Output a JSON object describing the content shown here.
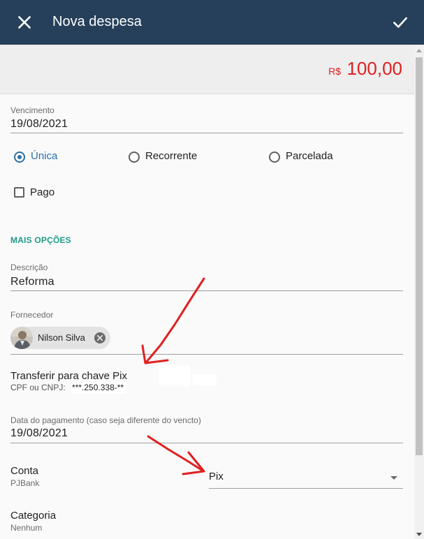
{
  "header": {
    "title": "Nova despesa",
    "close_icon": "close-icon",
    "confirm_icon": "check-icon",
    "background": "#263f5a"
  },
  "amount": {
    "currency": "R$",
    "value": "100,00",
    "color": "#e02020"
  },
  "form": {
    "due_date": {
      "label": "Vencimento",
      "value": "19/08/2021"
    },
    "recurrence": {
      "options": [
        "Única",
        "Recorrente",
        "Parcelada"
      ],
      "selected": "Única"
    },
    "paid": {
      "label": "Pago",
      "checked": false
    },
    "more_options_label": "MAIS OPÇÕES",
    "description": {
      "label": "Descrição",
      "value": "Reforma"
    },
    "supplier": {
      "label": "Fornecedor",
      "chip": "Nilson Silva"
    },
    "pix": {
      "title": "Transferir para chave Pix",
      "doc_label": "CPF ou CNPJ:",
      "doc_value": "***.250.338-**"
    },
    "payment_date": {
      "label": "Data do pagamento (caso seja diferente do vencto)",
      "value": "19/08/2021"
    },
    "account": {
      "label": "Conta",
      "value": "PJBank",
      "method": "Pix"
    },
    "category": {
      "label": "Categoria",
      "value": "Nenhum"
    }
  },
  "colors": {
    "accent": "#2a6fa8",
    "section": "#1e9b87",
    "annotation_arrows": "#e02020"
  }
}
